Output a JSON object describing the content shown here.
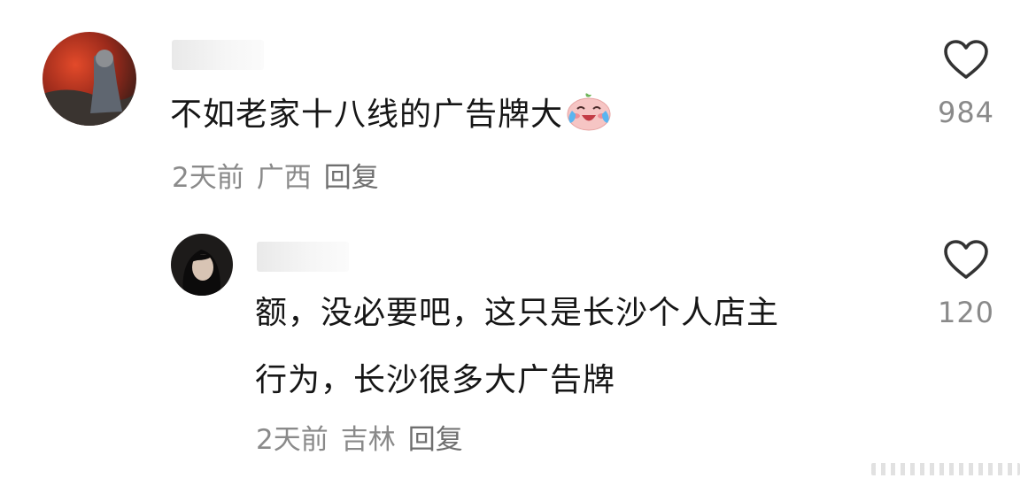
{
  "comments": [
    {
      "text": "不如老家十八线的广告牌大",
      "emoji": "laughing-crying-peach-emoji",
      "time": "2天前",
      "location": "广西",
      "reply": "回复",
      "likes": "984"
    },
    {
      "text_line1": "额，没必要吧，这只是长沙个人店主",
      "text_line2": "行为，长沙很多大广告牌",
      "time": "2天前",
      "location": "吉林",
      "reply": "回复",
      "likes": "120"
    }
  ],
  "icons": {
    "like": "heart-outline-icon"
  },
  "colors": {
    "text": "#161616",
    "meta": "#8a8a8a",
    "heart_stroke": "#333333"
  }
}
